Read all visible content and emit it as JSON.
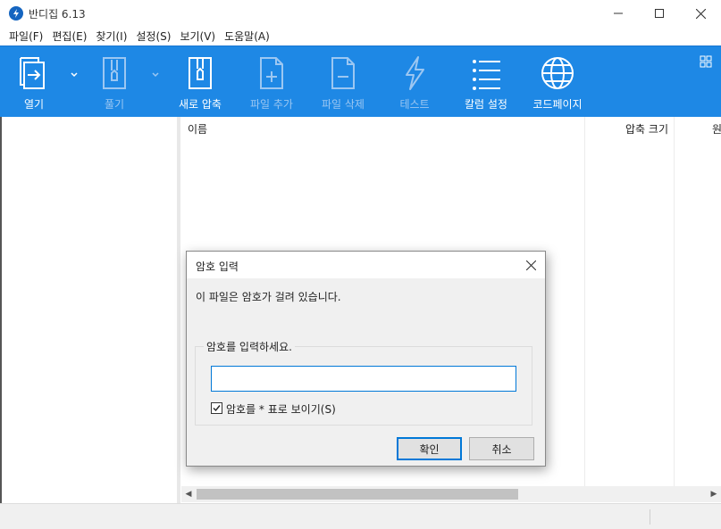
{
  "window": {
    "title": "반디집 6.13"
  },
  "menu": [
    "파일(F)",
    "편집(E)",
    "찾기(I)",
    "설정(S)",
    "보기(V)",
    "도움말(A)"
  ],
  "toolbar": {
    "open": "열기",
    "extract": "풀기",
    "new_archive": "새로 압축",
    "add_file": "파일 추가",
    "delete_file": "파일 삭제",
    "test": "테스트",
    "column_settings": "칼럼 설정",
    "codepage": "코드페이지"
  },
  "list": {
    "columns": {
      "name": "이름",
      "compressed_size": "압축 크기",
      "original": "원"
    }
  },
  "dialog": {
    "title": "암호 입력",
    "message": "이 파일은 암호가 걸려 있습니다.",
    "group_label": "암호를 입력하세요.",
    "password_value": "",
    "show_password_label": "암호를 * 표로 보이기(S)",
    "show_password_checked": true,
    "ok": "확인",
    "cancel": "취소"
  },
  "colors": {
    "toolbar": "#1e88e5",
    "toolbar_disabled_text": "#9cc7f2",
    "accent": "#0078d7"
  }
}
